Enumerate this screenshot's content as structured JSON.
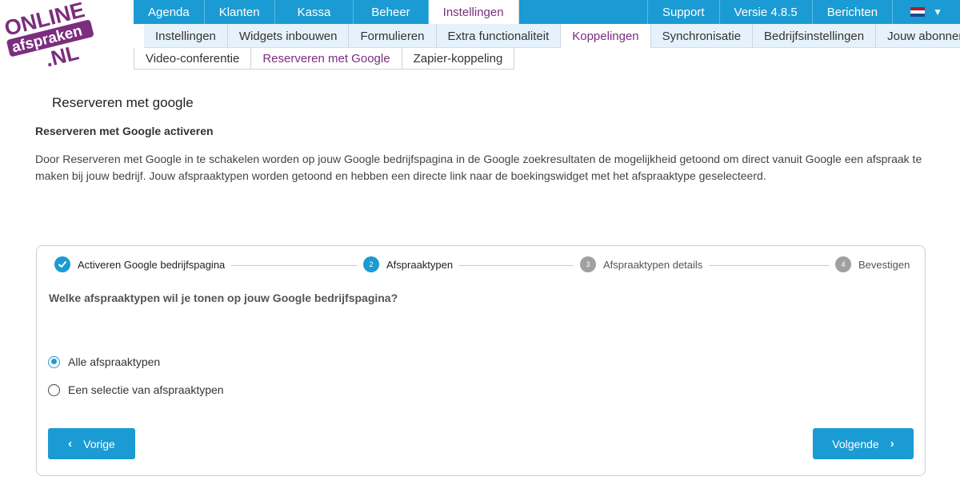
{
  "logo": {
    "line1": "ONLINE",
    "line2": "afspraken",
    "line3": ".NL",
    "colors": {
      "purple": "#7b2d7e",
      "pink": "#e84c8b",
      "white": "#ffffff"
    }
  },
  "topnav": {
    "items": [
      {
        "label": "Agenda"
      },
      {
        "label": "Klanten"
      },
      {
        "label": "Kassa"
      },
      {
        "label": "Beheer"
      },
      {
        "label": "Instellingen",
        "active": true
      }
    ],
    "right_items": [
      {
        "label": "Support"
      },
      {
        "label": "Versie 4.8.5"
      },
      {
        "label": "Berichten"
      }
    ],
    "language_flag": "netherlands-flag-icon"
  },
  "subnav": {
    "items": [
      {
        "label": "Instellingen"
      },
      {
        "label": "Widgets inbouwen"
      },
      {
        "label": "Formulieren"
      },
      {
        "label": "Extra functionaliteit"
      },
      {
        "label": "Koppelingen",
        "active": true
      },
      {
        "label": "Synchronisatie"
      },
      {
        "label": "Bedrijfsinstellingen"
      },
      {
        "label": "Jouw abonnement"
      }
    ]
  },
  "thirdnav": {
    "items": [
      {
        "label": "Video-conferentie"
      },
      {
        "label": "Reserveren met Google",
        "active": true
      },
      {
        "label": "Zapier-koppeling"
      }
    ]
  },
  "page": {
    "title": "Reserveren met google",
    "section_heading": "Reserveren met Google activeren",
    "description": "Door Reserveren met Google in te schakelen worden op jouw Google bedrijfspagina in de Google zoekresultaten de mogelijkheid getoond om direct vanuit Google een afspraak te maken bij jouw bedrijf. Jouw afspraaktypen worden getoond en hebben een directe link naar de boekingswidget met het afspraaktype geselecteerd."
  },
  "wizard": {
    "steps": [
      {
        "number": "1",
        "label": "Activeren Google bedrijfspagina",
        "state": "done"
      },
      {
        "number": "2",
        "label": "Afspraaktypen",
        "state": "current"
      },
      {
        "number": "3",
        "label": "Afspraaktypen details",
        "state": "todo"
      },
      {
        "number": "4",
        "label": "Bevestigen",
        "state": "todo"
      }
    ],
    "question": "Welke afspraaktypen wil je tonen op jouw Google bedrijfspagina?",
    "options": [
      {
        "label": "Alle afspraaktypen",
        "checked": true
      },
      {
        "label": "Een selectie van afspraaktypen",
        "checked": false
      }
    ],
    "prev_label": "Vorige",
    "next_label": "Volgende"
  },
  "colors": {
    "accent": "#1b9bd3",
    "active_text": "#7b2d7e",
    "subnav_bg": "#e6f2fb",
    "step_todo": "#a0a0a0"
  }
}
